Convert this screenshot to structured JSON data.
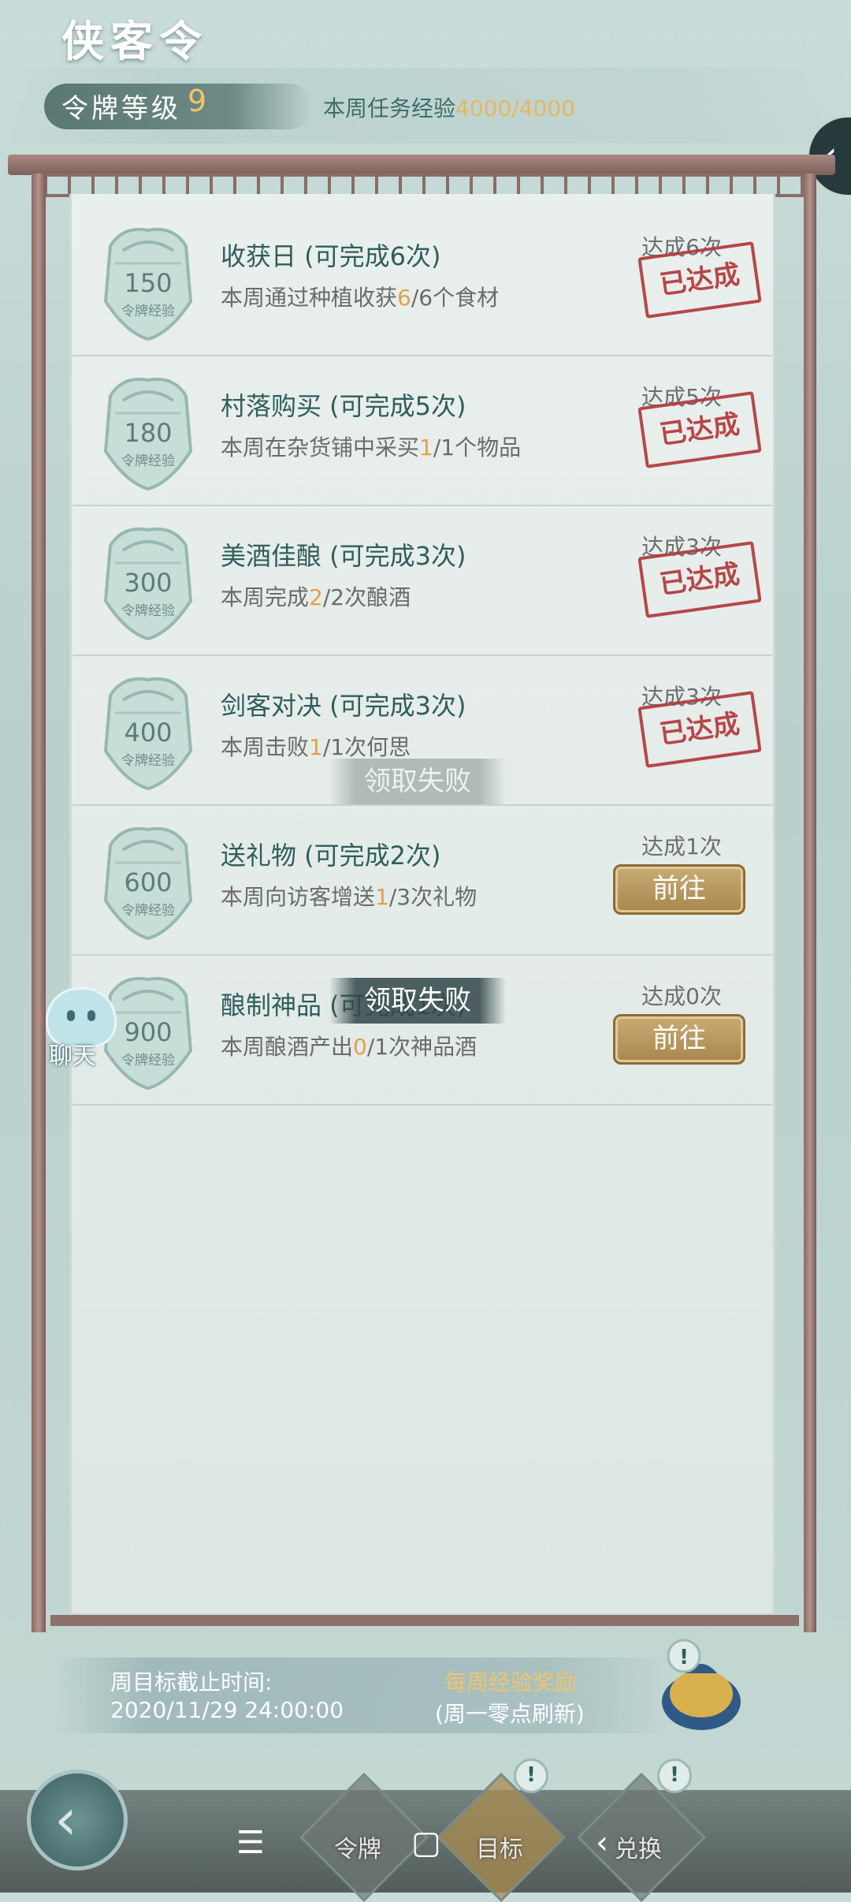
{
  "header": {
    "title": "侠客令",
    "level_label": "令牌等级",
    "level_value": "9",
    "weekly_exp_label": "本周任务经验",
    "weekly_exp_value": "4000/4000"
  },
  "tasks": [
    {
      "exp": "150",
      "exp_caption": "令牌经验",
      "title": "收获日 (可完成6次)",
      "desc_pre": "本周通过种植收获",
      "progress": "6",
      "desc_post": "/6个食材",
      "count": "达成6次",
      "status": "已达成"
    },
    {
      "exp": "180",
      "exp_caption": "令牌经验",
      "title": "村落购买 (可完成5次)",
      "desc_pre": "本周在杂货铺中采买",
      "progress": "1",
      "desc_post": "/1个物品",
      "count": "达成5次",
      "status": "已达成"
    },
    {
      "exp": "300",
      "exp_caption": "令牌经验",
      "title": "美酒佳酿 (可完成3次)",
      "desc_pre": "本周完成",
      "progress": "2",
      "desc_post": "/2次酿酒",
      "count": "达成3次",
      "status": "已达成"
    },
    {
      "exp": "400",
      "exp_caption": "令牌经验",
      "title": "剑客对决 (可完成3次)",
      "desc_pre": "本周击败",
      "progress": "1",
      "desc_post": "/1次何思",
      "count": "达成3次",
      "status": "已达成"
    },
    {
      "exp": "600",
      "exp_caption": "令牌经验",
      "title": "送礼物 (可完成2次)",
      "desc_pre": "本周向访客增送",
      "progress": "1",
      "desc_post": "/3次礼物",
      "count": "达成1次",
      "button": "前往"
    },
    {
      "exp": "900",
      "exp_caption": "令牌经验",
      "title": "酿制神品 (可完成1次)",
      "desc_pre": "本周酿酒产出",
      "progress": "0",
      "desc_post": "/1次神品酒",
      "count": "达成0次",
      "button": "前往"
    }
  ],
  "toasts": [
    "领取失败",
    "领取失败"
  ],
  "chat": {
    "label": "聊天"
  },
  "footer": {
    "deadline_label": "周目标截止时间:",
    "deadline_value": "2020/11/29 24:00:00",
    "reward_title": "每周经验奖励",
    "reward_note": "(周一零点刷新)"
  },
  "tabs": [
    {
      "label": "令牌",
      "icon": "token-icon",
      "alert": false
    },
    {
      "label": "目标",
      "icon": "target-icon",
      "alert": true
    },
    {
      "label": "兑换",
      "icon": "exchange-icon",
      "alert": true
    }
  ],
  "alert_glyph": "!",
  "system_nav": {
    "menu": "☰",
    "home": "▢",
    "back": "‹"
  },
  "colors": {
    "accent_gold": "#e0a24a",
    "stamp_red": "#b13a3c",
    "title_teal": "#2f5e5c",
    "button_gold": "#b8975f"
  }
}
